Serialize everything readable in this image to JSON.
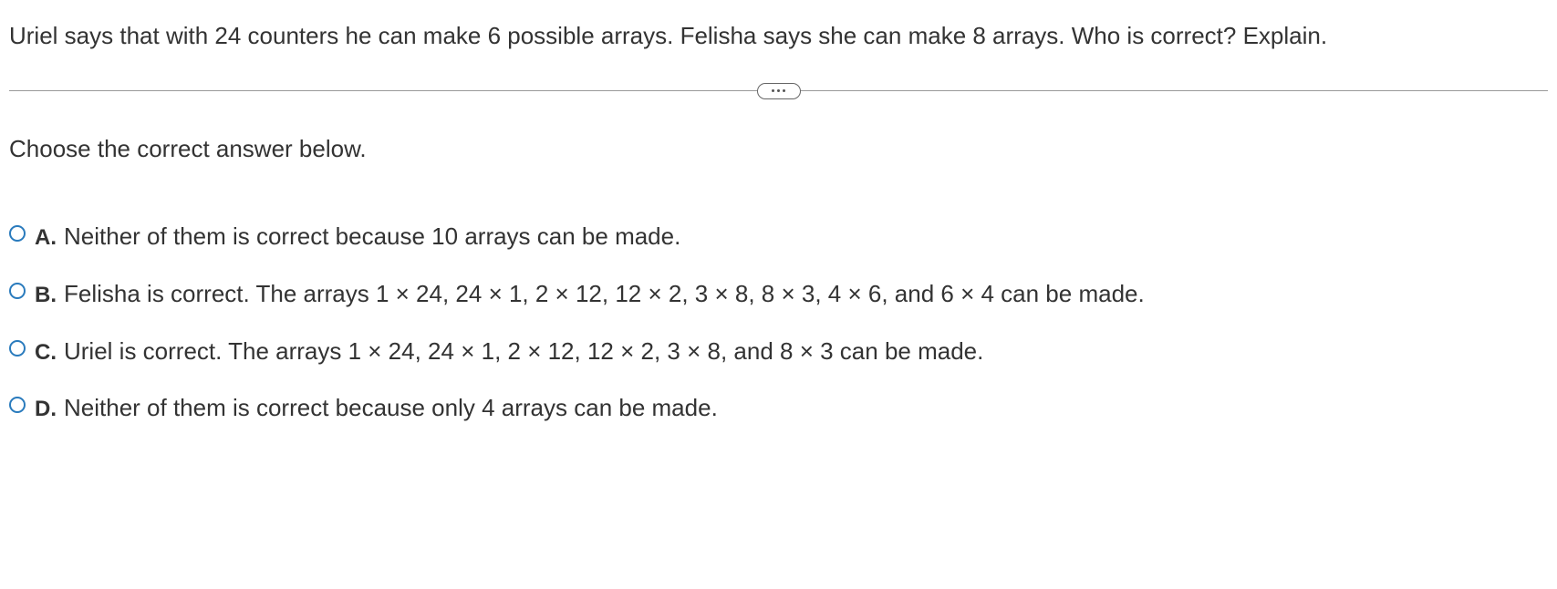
{
  "question": "Uriel says that with 24 counters he can make 6 possible arrays. Felisha says she can make 8 arrays. Who is correct? Explain.",
  "instruction": "Choose the correct answer below.",
  "options": [
    {
      "label": "A.",
      "text": "Neither of them is correct because 10 arrays can be made."
    },
    {
      "label": "B.",
      "text": "Felisha is correct. The arrays 1 × 24, 24 × 1, 2 × 12, 12 × 2, 3 × 8, 8 × 3, 4 × 6, and 6 × 4 can be made."
    },
    {
      "label": "C.",
      "text": "Uriel is correct. The arrays 1 × 24, 24 × 1, 2 × 12, 12 × 2, 3 × 8, and 8 × 3 can be made."
    },
    {
      "label": "D.",
      "text": "Neither of them is correct because only 4 arrays can be made."
    }
  ]
}
